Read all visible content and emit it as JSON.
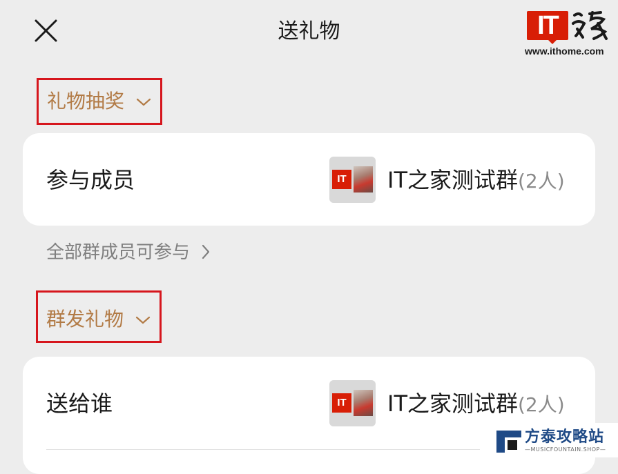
{
  "header": {
    "title": "送礼物",
    "close_icon": "close-icon"
  },
  "watermark": {
    "logo_text": "IT",
    "logo_side": "之家",
    "url": "www.ithome.com",
    "bottom_title": "方泰攻略站",
    "bottom_sub": "—MUSICFOUNTAIN.SHOP—"
  },
  "lottery_section": {
    "label": "礼物抽奖",
    "chevron_icon": "chevron-down-icon",
    "member_row": {
      "label": "参与成员",
      "avatar_text": "IT",
      "group_name": "IT之家测试群",
      "group_count": "(2人)"
    },
    "hint": "全部群成员可参与",
    "hint_icon": "chevron-right-icon"
  },
  "mass_section": {
    "label": "群发礼物",
    "chevron_icon": "chevron-down-icon",
    "recipient_row": {
      "label": "送给谁",
      "avatar_text": "IT",
      "group_name": "IT之家测试群",
      "group_count": "(2人)"
    }
  },
  "colors": {
    "accent_gold": "#b27b46",
    "highlight_red": "#d6161d",
    "brand_red": "#d81e06"
  }
}
